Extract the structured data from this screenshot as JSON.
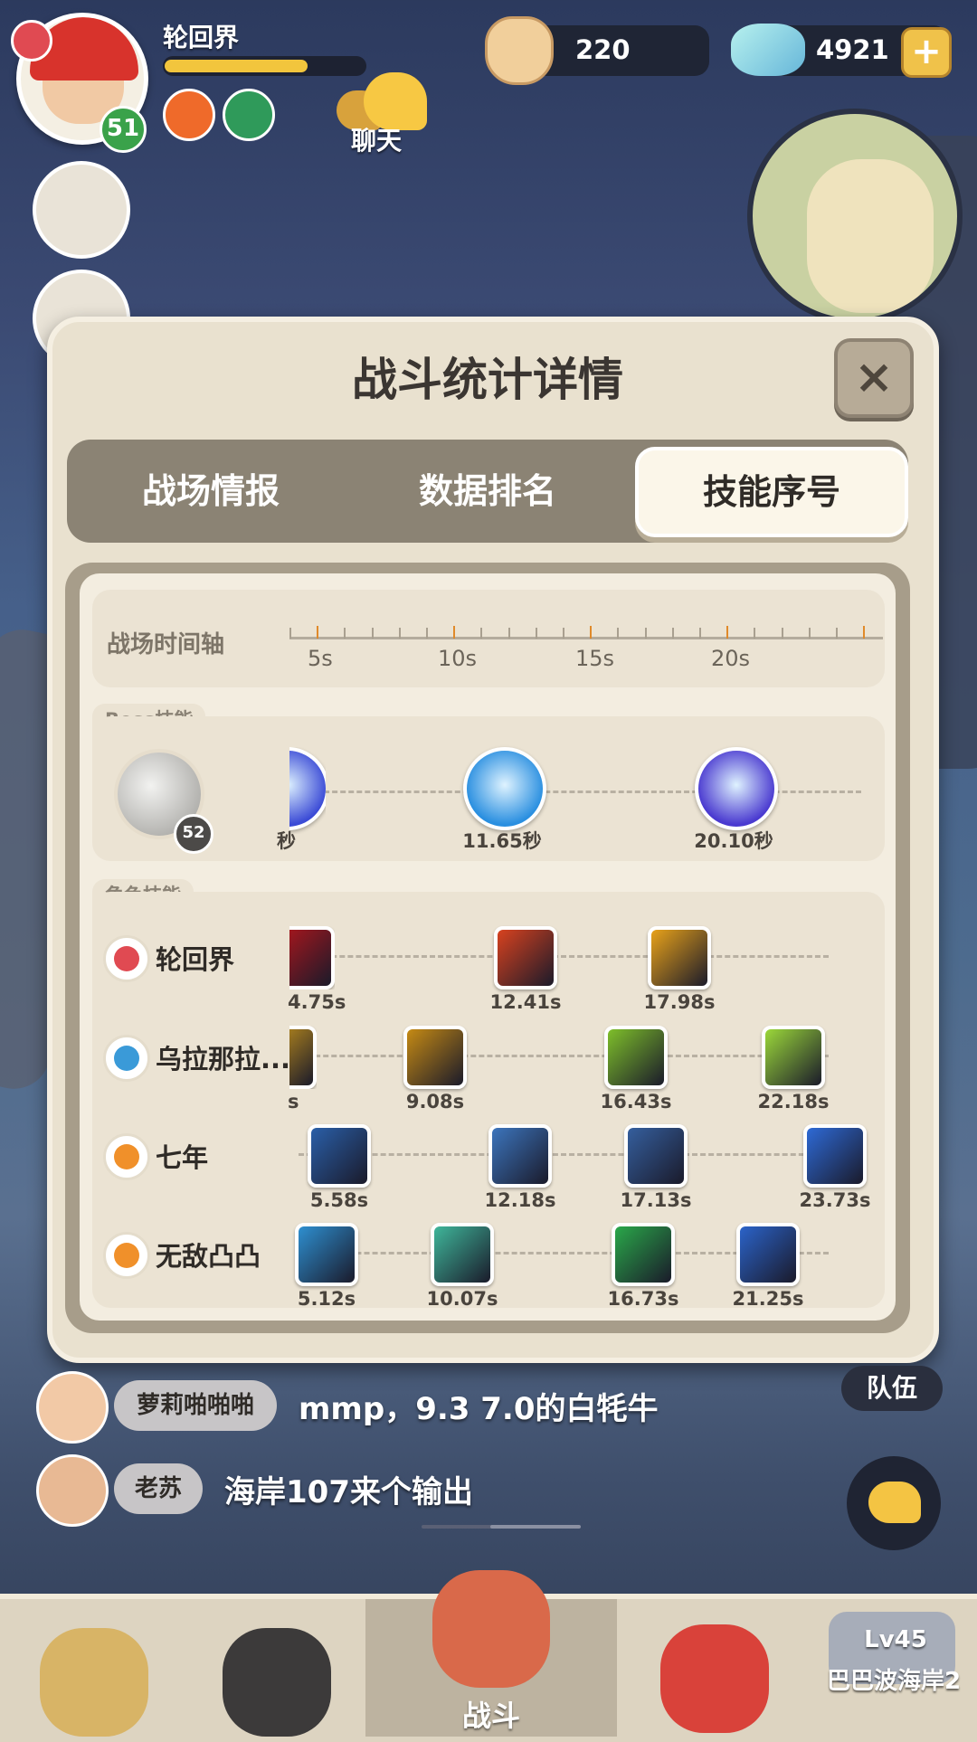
{
  "player": {
    "name": "轮回界",
    "level": "51",
    "hp_fraction": 0.7
  },
  "chat_button": {
    "label": "聊天"
  },
  "currency": {
    "pearls": "220",
    "gems": "4921",
    "add_label": "+"
  },
  "modal": {
    "title": "战斗统计详情",
    "close_label": "×",
    "tabs": [
      {
        "label": "战场情报",
        "active": false
      },
      {
        "label": "数据排名",
        "active": false
      },
      {
        "label": "技能序号",
        "active": true
      }
    ],
    "timeline": {
      "label": "战场时间轴",
      "ticks": [
        "5s",
        "10s",
        "15s",
        "20s"
      ]
    },
    "boss": {
      "section_label": "Boss技能",
      "level": "52",
      "skills": [
        {
          "time": "秒",
          "icon": "boss-skill-purple-icon",
          "color": "#3b4bd6"
        },
        {
          "time": "11.65秒",
          "icon": "boss-skill-wing-icon",
          "color": "#2a8fe0"
        },
        {
          "time": "20.10秒",
          "icon": "boss-skill-burst-icon",
          "color": "#4a3ad0"
        }
      ]
    },
    "characters": {
      "section_label": "角色技能",
      "rows": [
        {
          "name": "轮回界",
          "class_color": "#e04a52",
          "skills": [
            {
              "time": "4.75s",
              "color": "#b3161c"
            },
            {
              "time": "12.41s",
              "color": "#d8421f"
            },
            {
              "time": "17.98s",
              "color": "#e8a21a"
            }
          ]
        },
        {
          "name": "乌拉那拉...",
          "class_color": "#3a9ad8",
          "skills": [
            {
              "time": "s",
              "color": "#d8a01a"
            },
            {
              "time": "9.08s",
              "color": "#c58a14"
            },
            {
              "time": "16.43s",
              "color": "#7ebf2a"
            },
            {
              "time": "22.18s",
              "color": "#9bd83a"
            }
          ]
        },
        {
          "name": "七年",
          "class_color": "#f0902a",
          "skills": [
            {
              "time": "5.58s",
              "color": "#2a5fa8"
            },
            {
              "time": "12.18s",
              "color": "#3c75bd"
            },
            {
              "time": "17.13s",
              "color": "#355f9e"
            },
            {
              "time": "23.73s",
              "color": "#2e6ad6"
            }
          ]
        },
        {
          "name": "无敌凸凸",
          "class_color": "#f0902a",
          "skills": [
            {
              "time": "5.12s",
              "color": "#2e8fd0"
            },
            {
              "time": "10.07s",
              "color": "#3fb69a"
            },
            {
              "time": "16.73s",
              "color": "#2aa84a"
            },
            {
              "time": "21.25s",
              "color": "#2b63c9"
            }
          ]
        }
      ]
    }
  },
  "chat": [
    {
      "tag": "萝莉啪啪啪",
      "message": "mmp，9.3 7.0的白牦牛"
    },
    {
      "tag": "老苏",
      "message": "海岸107来个输出"
    }
  ],
  "team_button": {
    "label": "队伍"
  },
  "nav": {
    "battle_label": "战斗",
    "locked_level": "Lv45",
    "locked_map": "巴巴波海岸2"
  }
}
